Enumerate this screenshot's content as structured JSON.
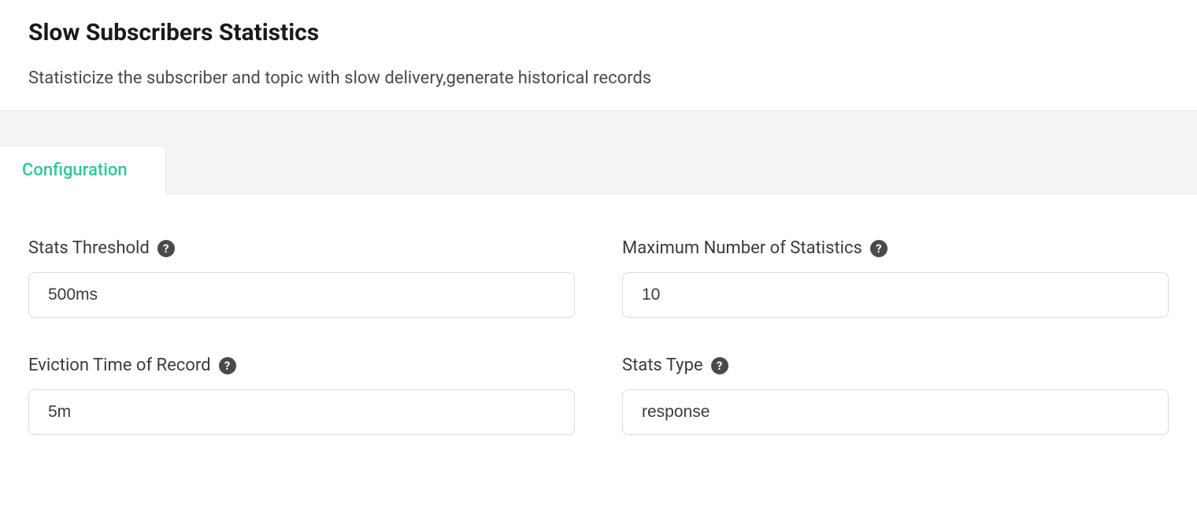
{
  "header": {
    "title": "Slow Subscribers Statistics",
    "description": "Statisticize the subscriber and topic with slow delivery,generate historical records"
  },
  "tabs": [
    {
      "label": "Configuration",
      "active": true
    }
  ],
  "form": {
    "stats_threshold": {
      "label": "Stats Threshold",
      "value": "500ms"
    },
    "max_stats": {
      "label": "Maximum Number of Statistics",
      "value": "10"
    },
    "eviction_time": {
      "label": "Eviction Time of Record",
      "value": "5m"
    },
    "stats_type": {
      "label": "Stats Type",
      "value": "response"
    }
  }
}
